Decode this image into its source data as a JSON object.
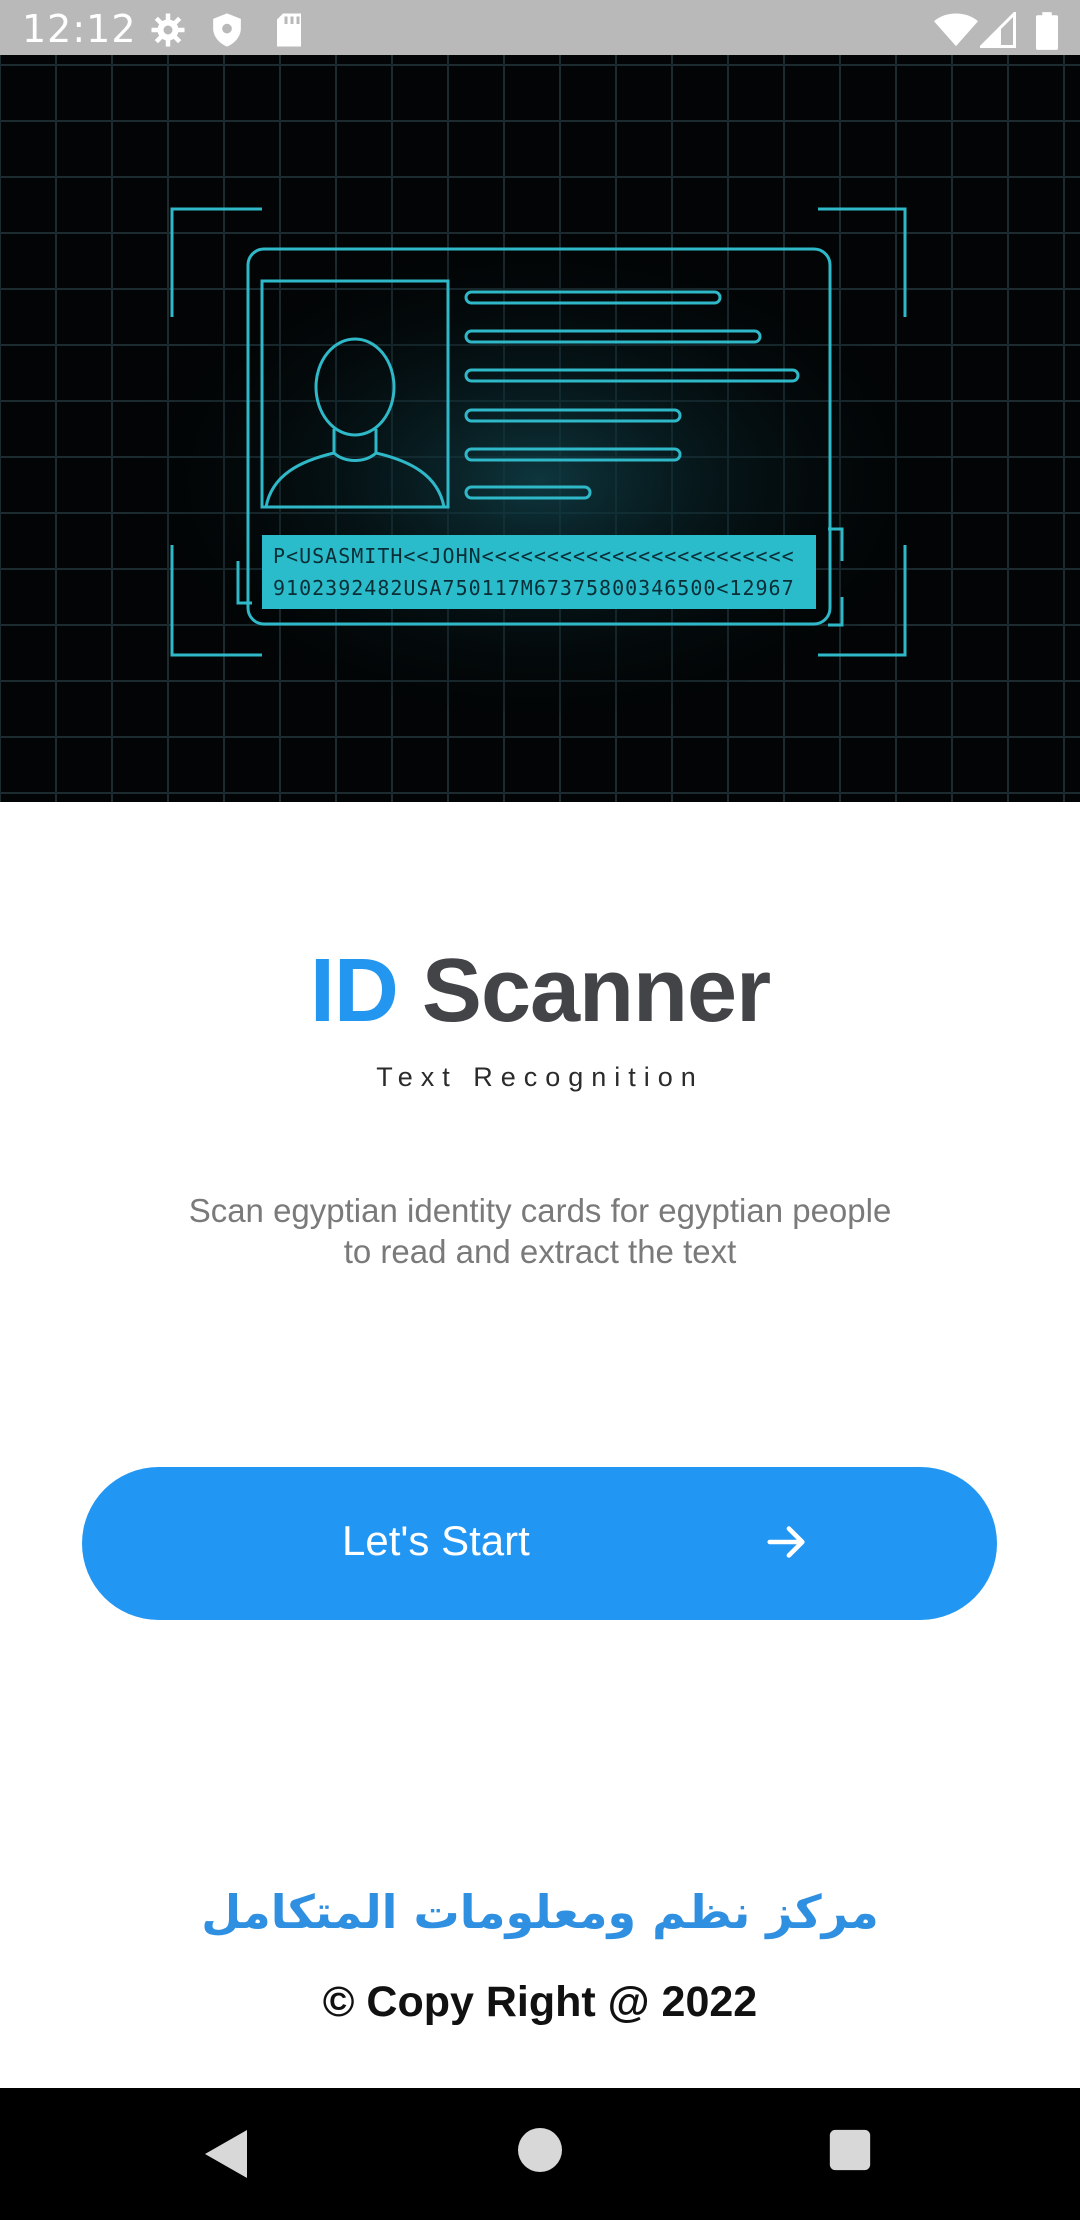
{
  "status_bar": {
    "time": "12:12",
    "left_icons": [
      "gear-icon",
      "shield-icon",
      "sd-card-icon"
    ],
    "right_icons": [
      "wifi-icon",
      "signal-icon",
      "battery-icon"
    ]
  },
  "hero": {
    "mrz_line_1": "P<USASMITH<<JOHN<<<<<<<<<<<<<<<<<<<<<<<<",
    "mrz_line_2": "9102392482USA750117M67375800346500<12967",
    "colors": {
      "line": "#2fb8c8",
      "mrz_bg": "#2bbccc",
      "grid": "#1b2b30"
    }
  },
  "title": {
    "accent": "ID",
    "main": "Scanner",
    "accent_color": "#2396f0"
  },
  "subtitle": "Text Recognition",
  "description": {
    "line_1": "Scan egyptian identity cards for egyptian people",
    "line_2": "to read and extract the text"
  },
  "start_button": {
    "label": "Let's Start",
    "icon": "arrow-right-icon",
    "color": "#2196f3"
  },
  "footer": {
    "organization": "مركز نظم ومعلومات المتكامل",
    "copyright": "© Copy Right @ 2022"
  },
  "nav_bar": {
    "buttons": [
      "back-icon",
      "home-icon",
      "recents-icon"
    ]
  }
}
